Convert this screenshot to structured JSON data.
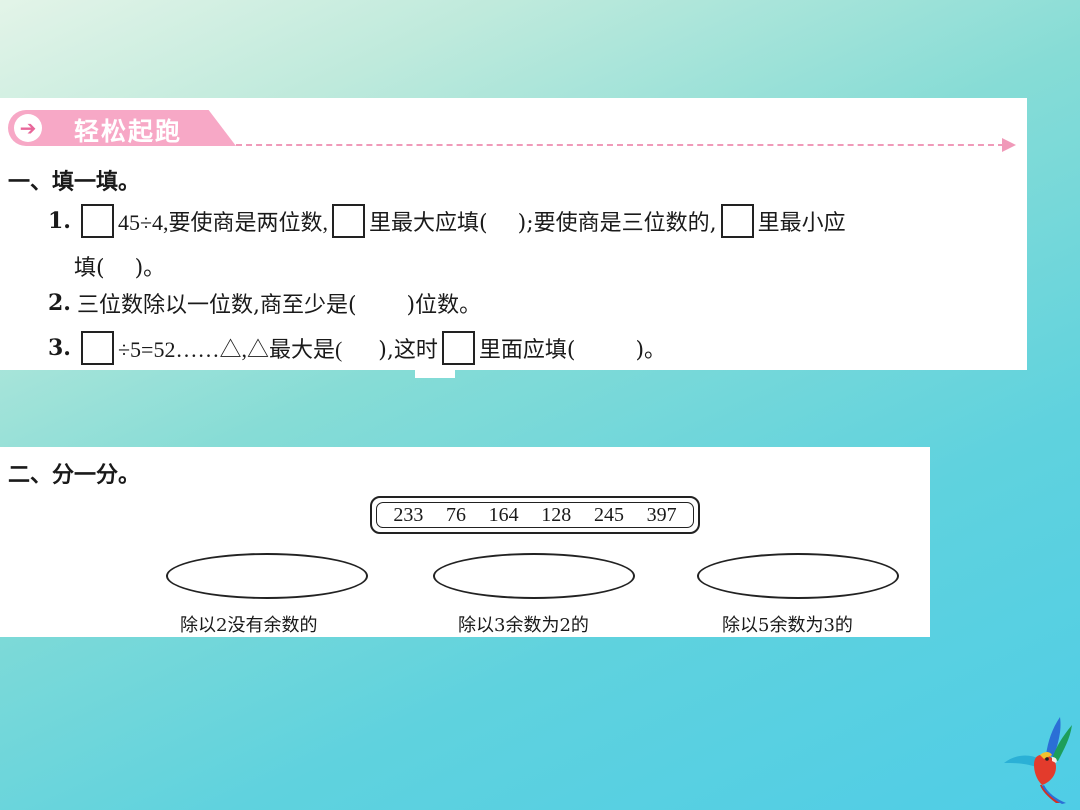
{
  "section1": {
    "banner_icon": "arrow-right-icon",
    "banner_title": "轻松起跑",
    "heading": "一、填一填。",
    "q1": {
      "num": "1.",
      "t1": "45÷4,要使商是两位数,",
      "t2": "里最大应填(",
      "t3": ");要使商是三位数的,",
      "t4": "里最小应",
      "t5": "填(",
      "t6": ")。"
    },
    "q2": {
      "num": "2.",
      "t1": "三位数除以一位数,商至少是(",
      "t2": ")位数。"
    },
    "q3": {
      "num": "3.",
      "t1": "÷5=52……△,△最大是(",
      "t2": "),这时",
      "t3": "里面应填(",
      "t4": ")。"
    }
  },
  "section2": {
    "heading": "二、分一分。",
    "numbers": [
      "233",
      "76",
      "164",
      "128",
      "245",
      "397"
    ],
    "groups": [
      "除以2没有余数的",
      "除以3余数为2的",
      "除以5余数为3的"
    ]
  },
  "colors": {
    "banner": "#f7a8c6",
    "dash": "#f09ab9",
    "background": "#5fd2de"
  },
  "decoration": {
    "corner_icon": "parrot-icon"
  }
}
